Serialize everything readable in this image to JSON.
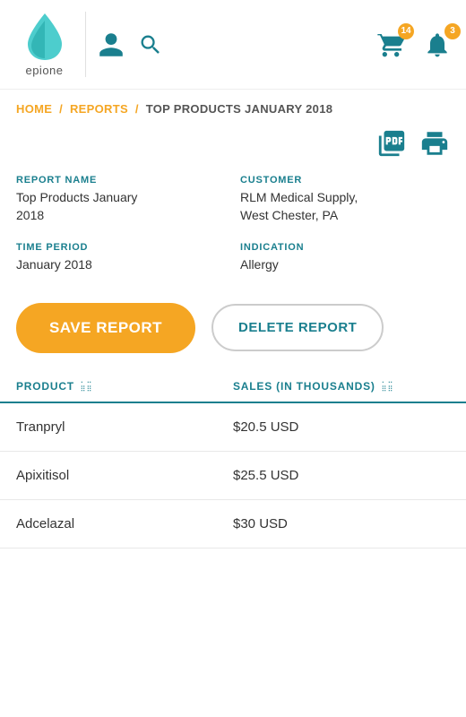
{
  "app": {
    "name": "epione"
  },
  "header": {
    "cart_badge": "14",
    "bell_badge": "3"
  },
  "breadcrumb": {
    "home": "HOME",
    "sep1": "/",
    "reports": "REPORTS",
    "sep2": "/",
    "current": "TOP PRODUCTS JANUARY 2018"
  },
  "report": {
    "name_label": "REPORT NAME",
    "name_value_line1": "Top Products January",
    "name_value_line2": "2018",
    "customer_label": "CUSTOMER",
    "customer_value_line1": "RLM Medical Supply,",
    "customer_value_line2": "West Chester, PA",
    "time_period_label": "TIME PERIOD",
    "time_period_value": "January 2018",
    "indication_label": "INDICATION",
    "indication_value": "Allergy"
  },
  "buttons": {
    "save": "SAVE REPORT",
    "delete": "DELETE REPORT"
  },
  "table": {
    "col_product": "PRODUCT",
    "col_sales": "SALES (IN THOUSANDS)",
    "rows": [
      {
        "product": "Tranpryl",
        "sales": "$20.5 USD"
      },
      {
        "product": "Apixitisol",
        "sales": "$25.5 USD"
      },
      {
        "product": "Adcelazal",
        "sales": "$30 USD"
      }
    ]
  }
}
